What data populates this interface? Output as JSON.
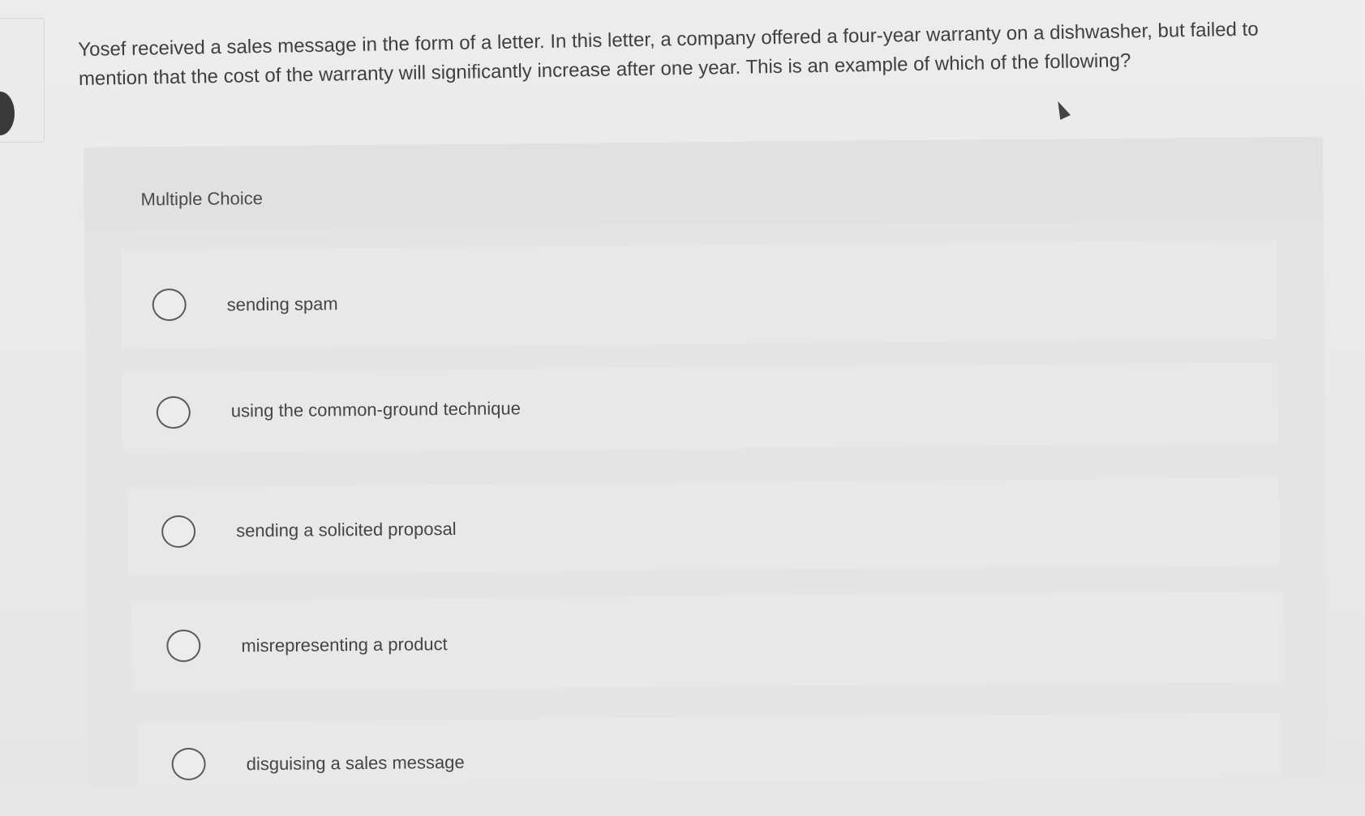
{
  "question": {
    "text": "Yosef received a sales message in the form of a letter. In this letter, a company offered a four-year warranty on a dishwasher, but failed to mention that the cost of the warranty will significantly increase after one year. This is an example of which of the following?"
  },
  "multiple_choice": {
    "label": "Multiple Choice",
    "options": [
      {
        "label": "sending spam"
      },
      {
        "label": "using the common-ground technique"
      },
      {
        "label": "sending a solicited proposal"
      },
      {
        "label": "misrepresenting a product"
      },
      {
        "label": "disguising a sales message"
      }
    ]
  }
}
